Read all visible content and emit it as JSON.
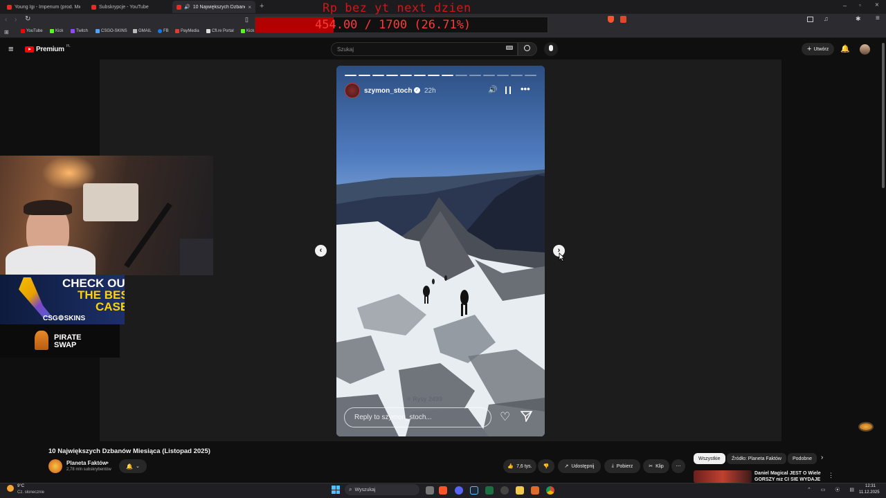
{
  "browser": {
    "tabs": [
      {
        "label": "Young Igi - Imperium (prod. Michał ..."
      },
      {
        "label": "Subskrypcje - YouTube"
      },
      {
        "label": "10 Największych Dzbanów M..."
      }
    ],
    "bookmarks": [
      {
        "label": "YouTube",
        "color": "#ff0000"
      },
      {
        "label": "Kick",
        "color": "#53fc18"
      },
      {
        "label": "Twitch",
        "color": "#9146ff"
      },
      {
        "label": "CSGO-SKINS",
        "color": "#4ba3ff"
      },
      {
        "label": "GMAIL",
        "color": "#bbbbbb"
      },
      {
        "label": "FB",
        "color": "#1877f2"
      },
      {
        "label": "PayMedia",
        "color": "#e53935"
      },
      {
        "label": "Cfl.re Portal",
        "color": "#dddddd"
      },
      {
        "label": "Kick",
        "color": "#53fc18"
      }
    ]
  },
  "stream_overlay": {
    "title": "Rp bez yt next dzien",
    "counter": "454.00 / 1700 (26.71%)",
    "progress_fraction": 0.2671,
    "color": "#b30000"
  },
  "youtube": {
    "logo_text": "Premium",
    "logo_region": "PL",
    "search_placeholder": "Szukaj",
    "create_label": "Utwórz"
  },
  "story": {
    "username": "szymon_stoch",
    "age": "22h",
    "location": "Rysy 2499",
    "reply_placeholder": "Reply to szymon_stoch...",
    "progress_segments": 14,
    "progress_active": 8
  },
  "video": {
    "title": "10 Największych Dzbanów Miesiąca (Listopad 2025)",
    "channel": "Planeta Faktów",
    "subscribers": "2,78 mln subskrybentów",
    "likes": "7,6 tys.",
    "share_label": "Udostępnij",
    "download_label": "Pobierz",
    "clip_label": "Klip"
  },
  "recommend_chips": [
    "Wszystkie",
    "Źródło: Planeta Faktów",
    "Podobne"
  ],
  "recommended": {
    "title_line1": "Daniel Magical JEST O Wiele",
    "title_line2": "GORSZY niż CI SIE WYDAJE"
  },
  "ads": {
    "ad1_line1": "CHECK OU",
    "ad1_line2": "THE BES",
    "ad1_line3": "CASE",
    "ad1_brand": "CSG⚙SKINS",
    "ad2_line1": "PIRATE",
    "ad2_line2": "SWAP"
  },
  "taskbar": {
    "weather_temp": "9°C",
    "weather_desc": "Cz. słonecznie",
    "search_label": "Wyszukaj",
    "time": "12:31",
    "date": "11.12.2025"
  }
}
